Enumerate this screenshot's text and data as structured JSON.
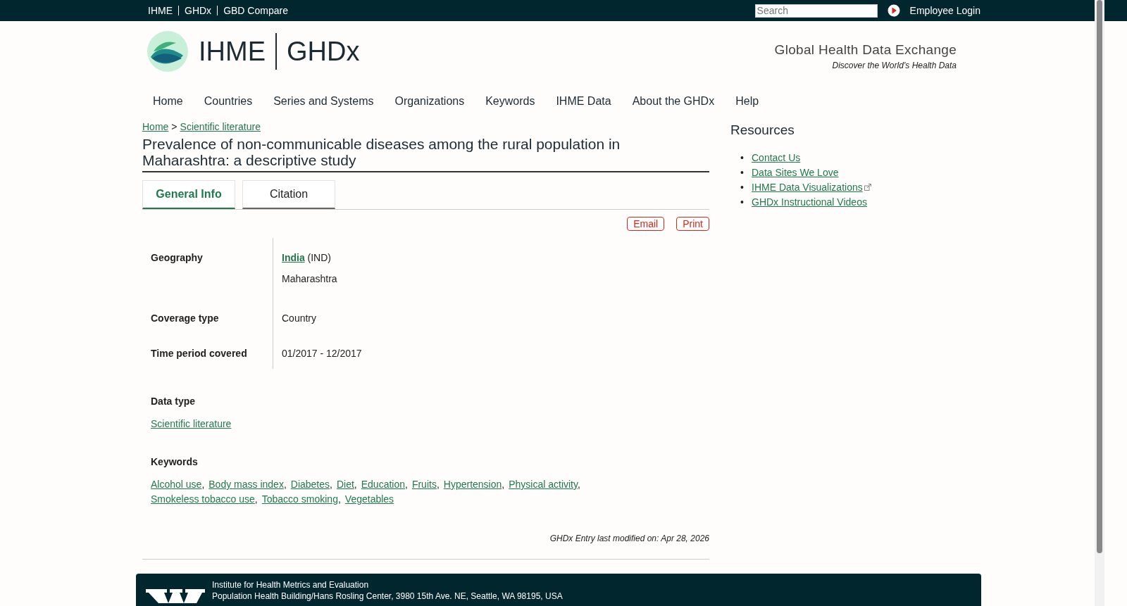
{
  "top_bar": {
    "links": [
      "IHME",
      "GHDx",
      "GBD Compare"
    ],
    "search": {
      "placeholder": "Search"
    },
    "login": "Employee Login"
  },
  "header": {
    "logo_left": "IHME",
    "logo_right": "GHDx",
    "tagline_title": "Global Health Data Exchange",
    "tagline_sub": "Discover the World’s Health Data"
  },
  "nav": [
    "Home",
    "Countries",
    "Series and Systems",
    "Organizations",
    "Keywords",
    "IHME Data",
    "About the GHDx",
    "Help"
  ],
  "breadcrumb": [
    {
      "label": "Home",
      "kind": "link"
    },
    {
      "label": ">",
      "kind": "sep"
    },
    {
      "label": "Scientific literature",
      "kind": "link"
    }
  ],
  "title": "Prevalence of non-communicable diseases among the rural population in Maharashtra: a descriptive study",
  "tabs": [
    {
      "label": "General Info",
      "selected": true
    },
    {
      "label": "Citation",
      "selected": false
    }
  ],
  "actions": [
    "Email",
    "Print"
  ],
  "info": [
    {
      "label": "Geography",
      "country": "India",
      "code": "(IND)",
      "region": "Maharashtra"
    },
    {
      "label": "Coverage type",
      "value": "Country"
    },
    {
      "label": "Time period covered",
      "value": "01/2017 - 12/2017"
    }
  ],
  "data_type": {
    "label": "Data type",
    "link": "Scientific literature"
  },
  "keywords": {
    "label": "Keywords",
    "separator": ",",
    "items": [
      "Alcohol use",
      "Body mass index",
      "Diabetes",
      "Diet",
      "Education",
      "Fruits",
      "Hypertension",
      "Physical activity",
      "Smokeless tobacco use",
      "Tobacco smoking",
      "Vegetables"
    ]
  },
  "modified": "GHDx Entry last modified on: Apr 28, 2026",
  "resources": {
    "title": "Resources",
    "marker": "•",
    "items": [
      {
        "label": "Contact Us",
        "external": false
      },
      {
        "label": "Data Sites We Love",
        "external": false
      },
      {
        "label": "IHME Data Visualizations",
        "external": true
      },
      {
        "label": "GHDx Instructional Videos",
        "external": false
      }
    ]
  },
  "footer": {
    "name": "Institute for Health Metrics and Evaluation",
    "address": "Population Health Building/Hans Rosling Center, 3980 15th Ave. NE, Seattle, WA 98195, USA"
  }
}
